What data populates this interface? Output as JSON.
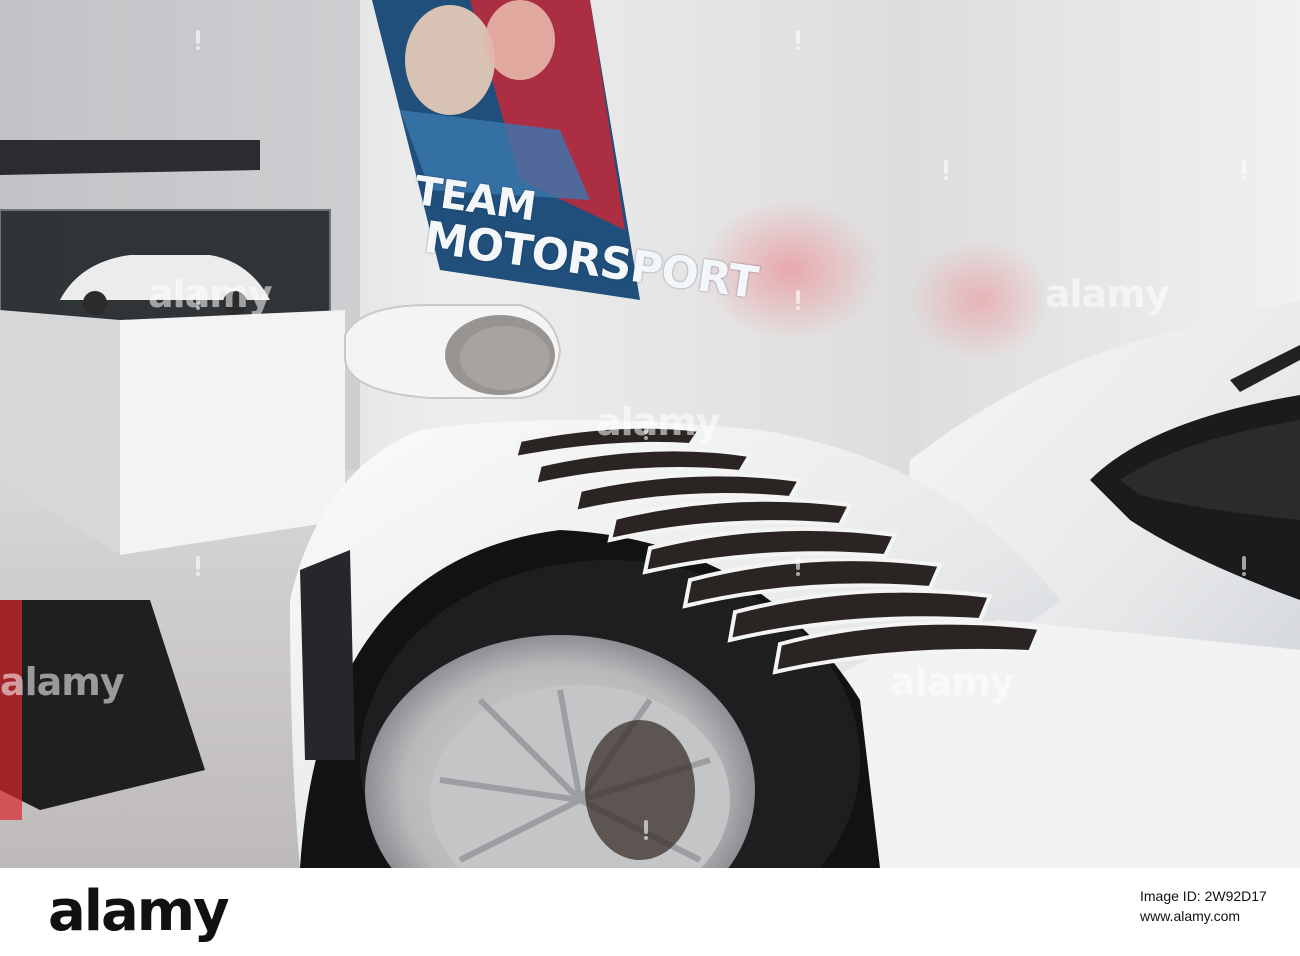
{
  "photo": {
    "poster_line1": "TEAM",
    "poster_line2": "MOTORSPORT"
  },
  "watermark": {
    "text": "alamy"
  },
  "footer": {
    "logo": "alamy",
    "image_id_label": "Image ID: 2W92D17",
    "url": "www.alamy.com"
  }
}
